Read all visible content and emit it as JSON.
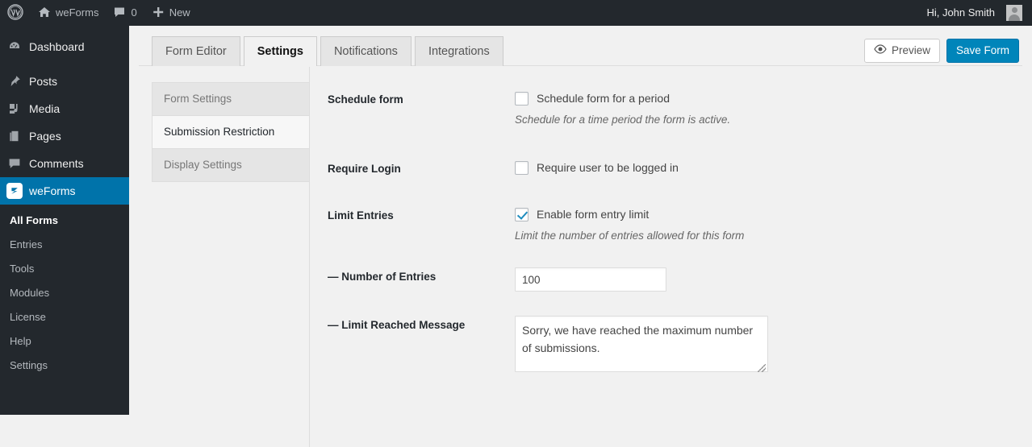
{
  "adminbar": {
    "wp_logo_icon": "wordpress-icon",
    "site_icon": "home-icon",
    "site_name": "weForms",
    "comments_icon": "comment-bubble-icon",
    "comments_count": "0",
    "new_icon": "plus-icon",
    "new_label": "New",
    "greeting": "Hi, John Smith",
    "avatar_icon": "user-avatar-icon"
  },
  "sidebar": {
    "items": [
      {
        "label": "Dashboard",
        "icon": "dashboard-gauge-icon",
        "current": false
      },
      {
        "label": "Posts",
        "icon": "pushpin-icon",
        "current": false
      },
      {
        "label": "Media",
        "icon": "media-music-icon",
        "current": false
      },
      {
        "label": "Pages",
        "icon": "pages-icon",
        "current": false
      },
      {
        "label": "Comments",
        "icon": "comment-bubble-icon",
        "current": false
      },
      {
        "label": "weForms",
        "icon": "weforms-logo-icon",
        "current": true
      }
    ],
    "submenu": [
      {
        "label": "All Forms",
        "current": true
      },
      {
        "label": "Entries",
        "current": false
      },
      {
        "label": "Tools",
        "current": false
      },
      {
        "label": "Modules",
        "current": false
      },
      {
        "label": "License",
        "current": false
      },
      {
        "label": "Help",
        "current": false
      },
      {
        "label": "Settings",
        "current": false
      }
    ]
  },
  "tabs": [
    {
      "label": "Form Editor",
      "active": false
    },
    {
      "label": "Settings",
      "active": true
    },
    {
      "label": "Notifications",
      "active": false
    },
    {
      "label": "Integrations",
      "active": false
    }
  ],
  "actions": {
    "preview_label": "Preview",
    "preview_icon": "eye-icon",
    "save_label": "Save Form"
  },
  "settings_nav": [
    {
      "label": "Form Settings",
      "active": false
    },
    {
      "label": "Submission Restriction",
      "active": true
    },
    {
      "label": "Display Settings",
      "active": false
    }
  ],
  "fields": {
    "schedule": {
      "label": "Schedule form",
      "checkbox_label": "Schedule form for a period",
      "checked": false,
      "help": "Schedule for a time period the form is active."
    },
    "require_login": {
      "label": "Require Login",
      "checkbox_label": "Require user to be logged in",
      "checked": false
    },
    "limit_entries": {
      "label": "Limit Entries",
      "checkbox_label": "Enable form entry limit",
      "checked": true,
      "help": "Limit the number of entries allowed for this form"
    },
    "number_of_entries": {
      "label": "— Number of Entries",
      "value": "100"
    },
    "limit_reached_message": {
      "label": "— Limit Reached Message",
      "value": "Sorry, we have reached the maximum number of submissions."
    }
  },
  "colors": {
    "admin_dark": "#23282d",
    "accent_blue": "#0073aa",
    "primary_button": "#0085ba",
    "page_bg": "#f1f1f1",
    "check_blue": "#1e8cbe"
  }
}
